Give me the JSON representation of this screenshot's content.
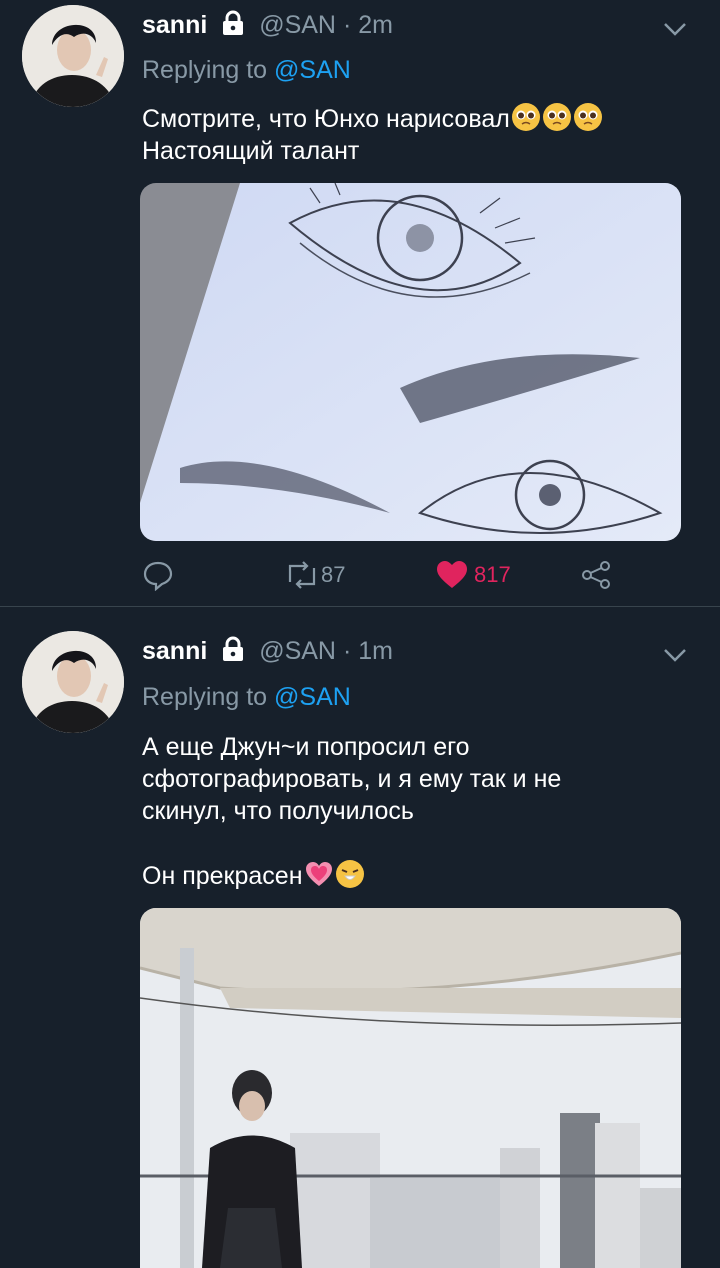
{
  "tweets": [
    {
      "name": "sanni",
      "handle": "@SAN",
      "sep": "·",
      "time": "2m",
      "replying_prefix": "Replying to",
      "replying_to": "@SAN",
      "text_lines": [
        "Смотрите, что Юнхо нарисовал",
        "Настоящий талант"
      ],
      "emoji": [
        "pleading-face",
        "pleading-face",
        "pleading-face"
      ],
      "media": "pencil-sketch-of-eyes-and-eyebrows",
      "retweets": "87",
      "likes": "817"
    },
    {
      "name": "sanni",
      "handle": "@SAN",
      "sep": "·",
      "time": "1m",
      "replying_prefix": "Replying to",
      "replying_to": "@SAN",
      "text_lines": [
        "А еще Джун~и попросил его",
        "сфотографировать, и я ему так и не",
        "скинул, что получилось",
        "",
        "Он прекрасен"
      ],
      "emoji": [
        "growing-heart",
        "sneezing-face"
      ],
      "media": "photo-of-man-on-rooftop-terrace"
    }
  ],
  "colors": {
    "background": "#17202b",
    "muted": "#8899a6",
    "accent": "#1da1f2",
    "like": "#e0245e"
  }
}
